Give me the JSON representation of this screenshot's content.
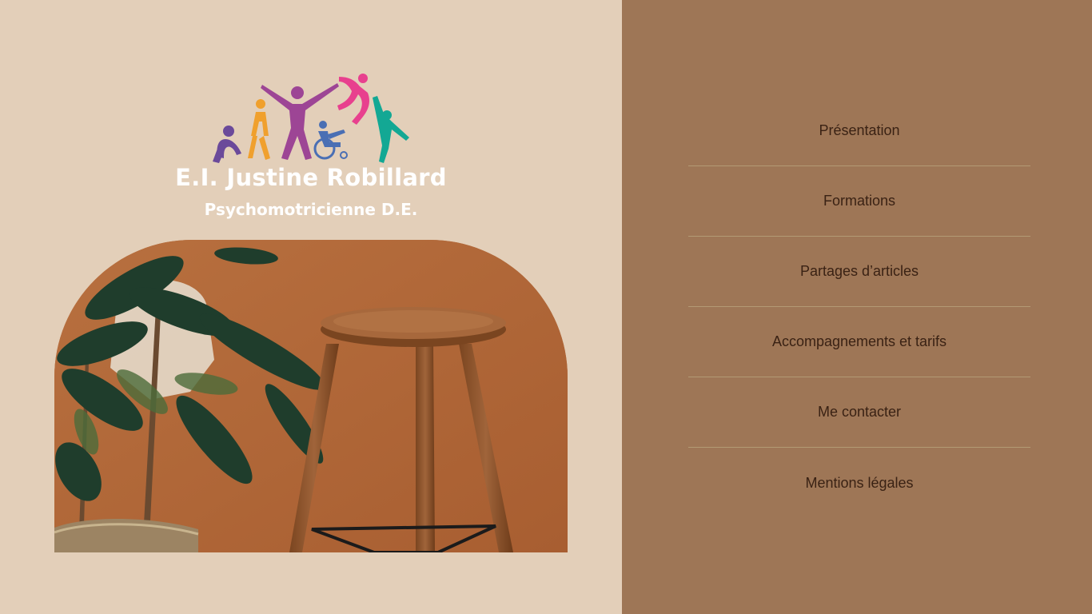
{
  "brand": {
    "name": "E.I. Justine Robillard",
    "subtitle": "Psychomotricienne D.E."
  },
  "nav": {
    "items": [
      {
        "label": "Présentation"
      },
      {
        "label": "Formations"
      },
      {
        "label": "Partages d’articles"
      },
      {
        "label": "Accompagnements et tarifs"
      },
      {
        "label": "Me contacter"
      },
      {
        "label": "Mentions légales"
      }
    ]
  },
  "colors": {
    "left_background": "#e3cfb9",
    "right_background": "#9e7656",
    "menu_text": "#3a2214",
    "divider": "#b39a74",
    "brand_text": "#ffffff"
  }
}
